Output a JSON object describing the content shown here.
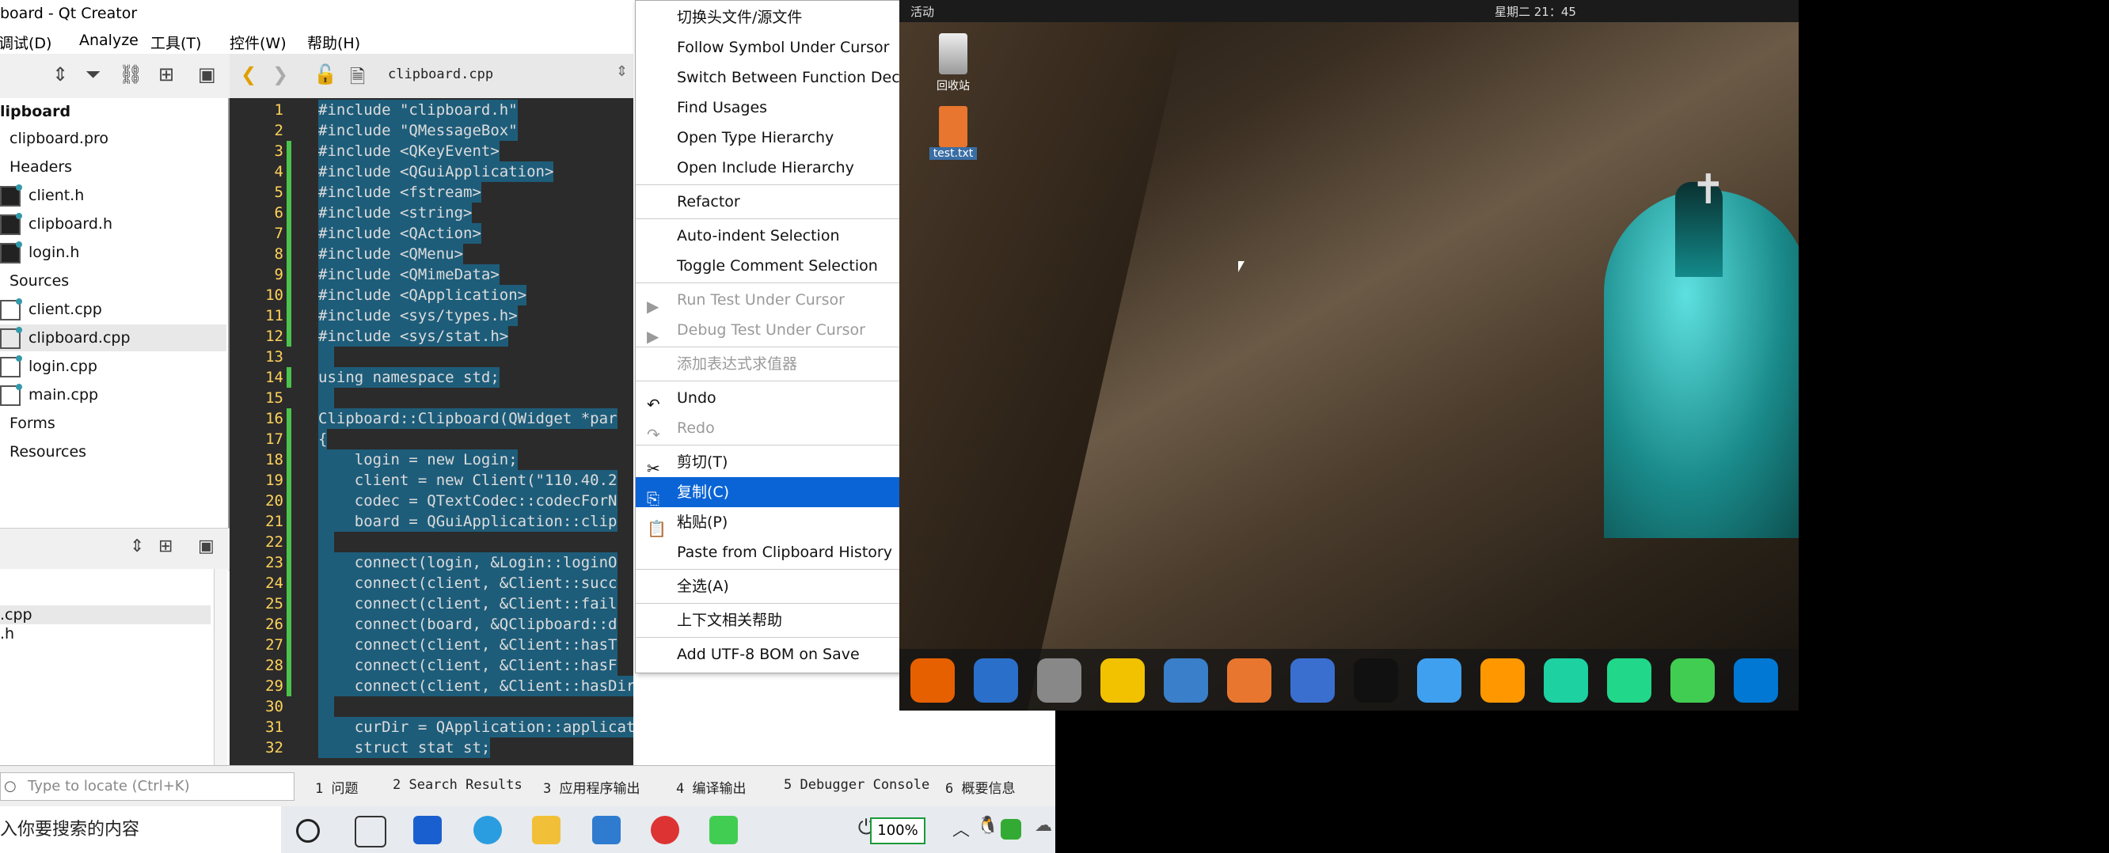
{
  "window": {
    "title": "board - Qt Creator"
  },
  "menubar": [
    "调试(D)",
    "Analyze",
    "工具(T)",
    "控件(W)",
    "帮助(H)"
  ],
  "project_tree": {
    "root": "lipboard",
    "items": [
      {
        "label": "clipboard.pro",
        "icon": "pro-file-icon",
        "indent": 1
      },
      {
        "label": "Headers",
        "icon": "folder-icon",
        "indent": 1
      },
      {
        "label": "client.h",
        "icon": "header-file-icon",
        "indent": 2
      },
      {
        "label": "clipboard.h",
        "icon": "header-file-icon",
        "indent": 2
      },
      {
        "label": "login.h",
        "icon": "header-file-icon",
        "indent": 2
      },
      {
        "label": "Sources",
        "icon": "folder-icon",
        "indent": 1
      },
      {
        "label": "client.cpp",
        "icon": "cpp-file-icon",
        "indent": 2
      },
      {
        "label": "clipboard.cpp",
        "icon": "cpp-file-icon",
        "indent": 2,
        "selected": true
      },
      {
        "label": "login.cpp",
        "icon": "cpp-file-icon",
        "indent": 2
      },
      {
        "label": "main.cpp",
        "icon": "cpp-file-icon",
        "indent": 2
      },
      {
        "label": "Forms",
        "icon": "folder-icon",
        "indent": 1
      },
      {
        "label": "Resources",
        "icon": "folder-icon",
        "indent": 1
      }
    ]
  },
  "open_docs": [
    ".cpp",
    ".h"
  ],
  "editor": {
    "filename": "clipboard.cpp",
    "lines": [
      {
        "n": "1",
        "t": "#include \"clipboard.h\""
      },
      {
        "n": "2",
        "t": "#include \"QMessageBox\""
      },
      {
        "n": "3",
        "t": "#include <QKeyEvent>"
      },
      {
        "n": "4",
        "t": "#include <QGuiApplication>"
      },
      {
        "n": "5",
        "t": "#include <fstream>"
      },
      {
        "n": "6",
        "t": "#include <string>"
      },
      {
        "n": "7",
        "t": "#include <QAction>"
      },
      {
        "n": "8",
        "t": "#include <QMenu>"
      },
      {
        "n": "9",
        "t": "#include <QMimeData>"
      },
      {
        "n": "10",
        "t": "#include <QApplication>"
      },
      {
        "n": "11",
        "t": "#include <sys/types.h>"
      },
      {
        "n": "12",
        "t": "#include <sys/stat.h>"
      },
      {
        "n": "13",
        "t": ""
      },
      {
        "n": "14",
        "t": "using namespace std;"
      },
      {
        "n": "15",
        "t": ""
      },
      {
        "n": "16",
        "t": "Clipboard::Clipboard(QWidget *par"
      },
      {
        "n": "17",
        "t": "{"
      },
      {
        "n": "18",
        "t": "    login = new Login;"
      },
      {
        "n": "19",
        "t": "    client = new Client(\"110.40.2"
      },
      {
        "n": "20",
        "t": "    codec = QTextCodec::codecForN"
      },
      {
        "n": "21",
        "t": "    board = QGuiApplication::clip"
      },
      {
        "n": "22",
        "t": ""
      },
      {
        "n": "23",
        "t": "    connect(login, &Login::loginO"
      },
      {
        "n": "24",
        "t": "    connect(client, &Client::succ"
      },
      {
        "n": "25",
        "t": "    connect(client, &Client::fail"
      },
      {
        "n": "26",
        "t": "    connect(board, &QClipboard::d"
      },
      {
        "n": "27",
        "t": "    connect(client, &Client::hasT"
      },
      {
        "n": "28",
        "t": "    connect(client, &Client::hasF"
      },
      {
        "n": "29",
        "t": "    connect(client, &Client::hasDirInfo, this, &Clipboard::on"
      },
      {
        "n": "30",
        "t": ""
      },
      {
        "n": "31",
        "t": "    curDir = QApplication::applicationDirPath() + \"/fileRecv\";"
      },
      {
        "n": "32",
        "t": "    struct stat st;"
      }
    ]
  },
  "context_menu": {
    "items": [
      {
        "label": "切换头文件/源文件",
        "state": "normal"
      },
      {
        "label": "Follow Symbol Under Cursor",
        "state": "normal"
      },
      {
        "label": "Switch Between Function Declara",
        "state": "normal"
      },
      {
        "label": "Find Usages",
        "state": "normal"
      },
      {
        "label": "Open Type Hierarchy",
        "state": "normal"
      },
      {
        "label": "Open Include Hierarchy",
        "state": "normal",
        "sep_after": true
      },
      {
        "label": "Refactor",
        "state": "normal",
        "sep_after": true
      },
      {
        "label": "Auto-indent Selection",
        "state": "normal"
      },
      {
        "label": "Toggle Comment Selection",
        "state": "normal",
        "sep_after": true
      },
      {
        "label": "Run Test Under Cursor",
        "state": "disabled",
        "icon": "run-test-icon"
      },
      {
        "label": "Debug Test Under Cursor",
        "state": "disabled",
        "icon": "debug-test-icon",
        "sep_after": true
      },
      {
        "label": "添加表达式求值器",
        "state": "disabled",
        "sep_after": true
      },
      {
        "label": "Undo",
        "state": "normal",
        "icon": "undo-icon"
      },
      {
        "label": "Redo",
        "state": "disabled",
        "icon": "redo-icon",
        "sep_after": true
      },
      {
        "label": "剪切(T)",
        "state": "normal",
        "icon": "scissors-icon"
      },
      {
        "label": "复制(C)",
        "state": "highlighted",
        "icon": "copy-icon"
      },
      {
        "label": "粘贴(P)",
        "state": "normal",
        "icon": "paste-icon"
      },
      {
        "label": "Paste from Clipboard History",
        "state": "normal",
        "sep_after": true
      },
      {
        "label": "全选(A)",
        "state": "normal",
        "sep_after": true
      },
      {
        "label": "上下文相关帮助",
        "state": "normal",
        "sep_after": true
      },
      {
        "label": "Add UTF-8 BOM on Save",
        "state": "normal"
      }
    ]
  },
  "bottom": {
    "locator_placeholder": "Type to locate (Ctrl+K)",
    "tabs": [
      "1  问题",
      "2  Search Results",
      "3  应用程序输出",
      "4  编译输出",
      "5  Debugger Console",
      "6  概要信息"
    ]
  },
  "win_taskbar": {
    "search_text": "入你要搜索的内容",
    "battery": "100%"
  },
  "ubuntu": {
    "activities": "活动",
    "clock": "星期二 21：45",
    "desktop_icons": [
      "回收站",
      "test.txt"
    ],
    "dock": [
      "firefox-icon",
      "thunderbird-icon",
      "files-icon",
      "rhythmbox-icon",
      "libreoffice-icon",
      "software-icon",
      "help-icon",
      "qq-icon",
      "baidunetdisk-icon",
      "sublime-icon",
      "pycharm-icon",
      "clion-icon",
      "qtcreator-icon",
      "vscode-icon"
    ]
  },
  "colors": {
    "menu_highlight": "#0a64d6",
    "line_number": "#ffd25a",
    "selection": "#1e5d7a"
  }
}
